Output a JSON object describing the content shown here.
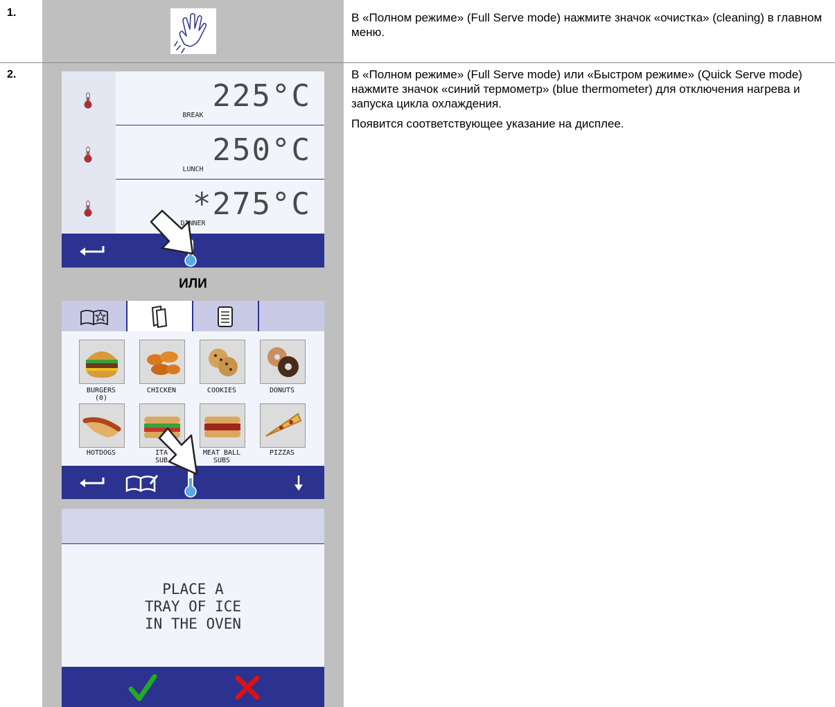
{
  "steps": [
    {
      "number": "1.",
      "text": "В «Полном режиме» (Full Serve mode) нажмите значок «очистка» (cleaning) в главном меню.",
      "icon": "cleaning-hand-icon"
    },
    {
      "number": "2.",
      "paragraphs": [
        "В «Полном режиме» (Full Serve mode) или «Быстром режиме» (Quick Serve mode) нажмите значок «синий термометр» (blue thermometer) для отключения нагрева и запуска цикла охлаждения.",
        "Появится соответствующее указание на дисплее."
      ]
    }
  ],
  "temp_screen": {
    "rows": [
      {
        "temp": "225°C",
        "label": "BREAK"
      },
      {
        "temp": "250°C",
        "label": "LUNCH"
      },
      {
        "temp": "*275°C",
        "label": "DINNER"
      }
    ],
    "icons": [
      "thermometer-icon",
      "back-arrow-icon",
      "blue-thermometer-icon",
      "pointer-arrow-icon"
    ]
  },
  "separator": "ИЛИ",
  "menu_screen": {
    "tabs": [
      "favorites-book-icon",
      "pages-icon",
      "document-icon"
    ],
    "items": [
      {
        "label": "BURGERS",
        "sub": "(0)",
        "icon": "burger-icon"
      },
      {
        "label": "CHICKEN",
        "sub": "",
        "icon": "chicken-icon"
      },
      {
        "label": "COOKIES",
        "sub": "",
        "icon": "cookies-icon"
      },
      {
        "label": "DONUTS",
        "sub": "",
        "icon": "donuts-icon"
      },
      {
        "label": "HOTDOGS",
        "sub": "",
        "icon": "hotdog-icon"
      },
      {
        "label": "ITA",
        "sub": "SUB",
        "icon": "italian-sub-icon"
      },
      {
        "label": "MEAT BALL",
        "sub": "SUBS",
        "icon": "meatball-sub-icon"
      },
      {
        "label": "PIZZAS",
        "sub": "",
        "icon": "pizza-icon"
      }
    ]
  },
  "ice_screen": {
    "lines": [
      "PLACE A",
      "TRAY OF ICE",
      "IN THE OVEN"
    ],
    "colors": {
      "confirm": "#22aa22",
      "cancel": "#dd1111",
      "bar": "#2b3290"
    }
  }
}
